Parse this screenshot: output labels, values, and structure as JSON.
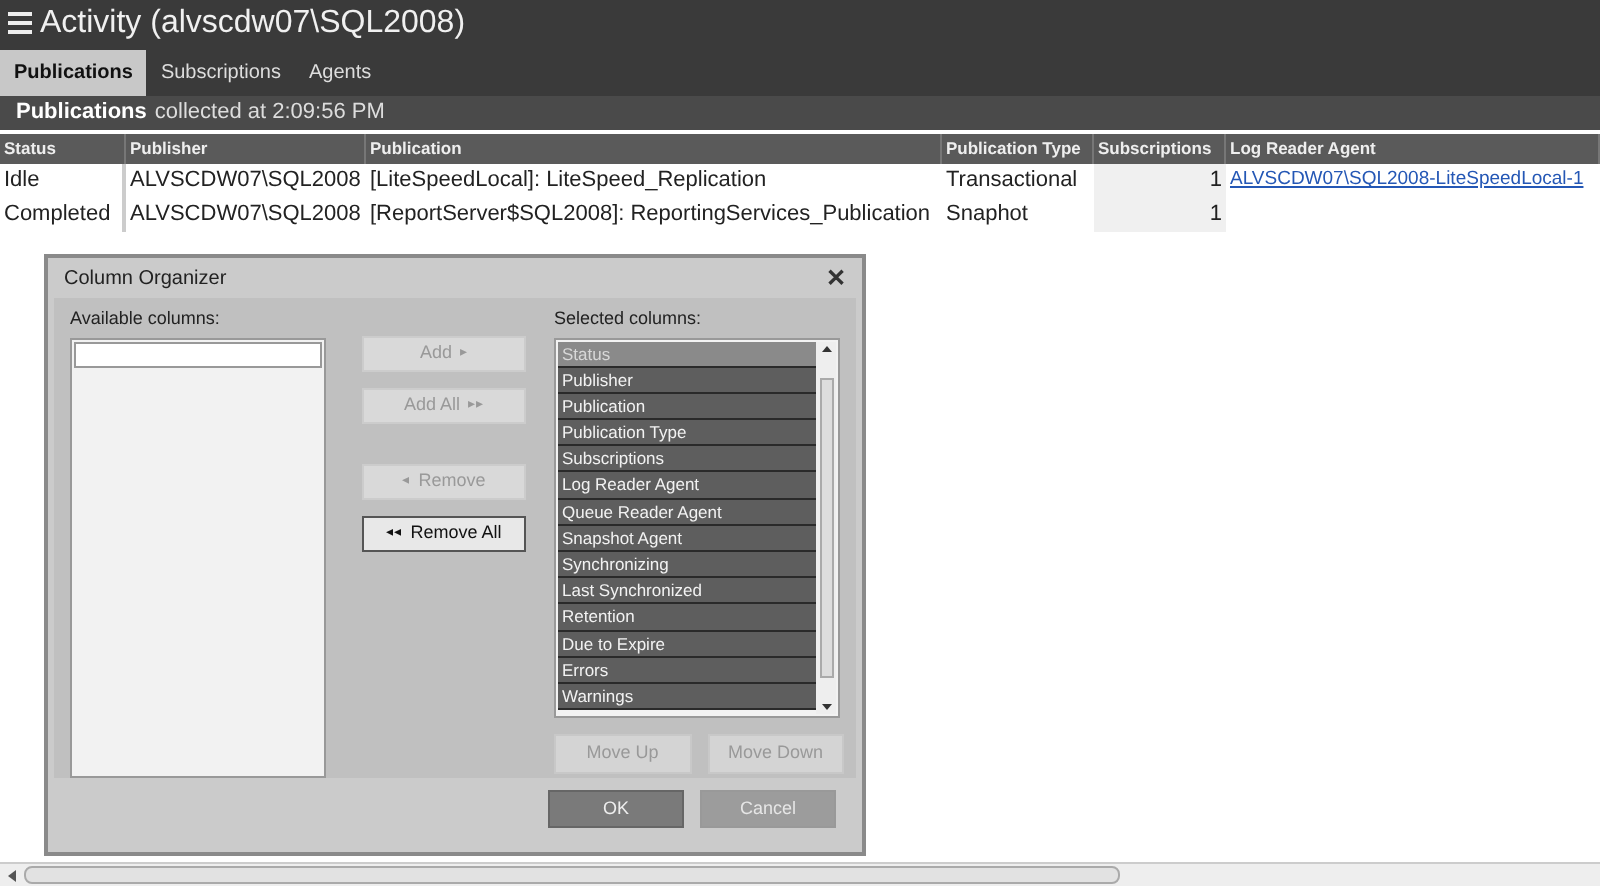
{
  "window": {
    "title": "Activity (alvscdw07\\SQL2008)"
  },
  "tabs": [
    {
      "label": "Publications",
      "selected": true
    },
    {
      "label": "Subscriptions",
      "selected": false
    },
    {
      "label": "Agents",
      "selected": false
    }
  ],
  "section": {
    "title": "Publications",
    "subtitle": "collected at 2:09:56 PM"
  },
  "table": {
    "columns": [
      "Status",
      "Publisher",
      "Publication",
      "Publication Type",
      "Subscriptions",
      "Log Reader Agent"
    ],
    "rows": [
      [
        "Idle",
        "ALVSCDW07\\SQL2008",
        "[LiteSpeedLocal]: LiteSpeed_Replication",
        "Transactional",
        "1",
        "ALVSCDW07\\SQL2008-LiteSpeedLocal-1"
      ],
      [
        "Completed",
        "ALVSCDW07\\SQL2008",
        "[ReportServer$SQL2008]: ReportingServices_Publication",
        "Snaphot",
        "1",
        ""
      ]
    ]
  },
  "dialog": {
    "title": "Column Organizer",
    "close": "✕",
    "available_label": "Available columns:",
    "selected_label": "Selected columns:",
    "middle_buttons": [
      {
        "label": "Add",
        "icon": "▸",
        "disabled": true
      },
      {
        "label": "Add All",
        "icon": "▸▸",
        "disabled": true
      },
      {
        "label": "Remove",
        "icon": "◂",
        "disabled": true
      },
      {
        "label": "Remove All",
        "icon": "◂◂",
        "disabled": false
      }
    ],
    "selected_columns": [
      {
        "label": "Status",
        "selected": true
      },
      {
        "label": "Publisher",
        "selected": false
      },
      {
        "label": "Publication",
        "selected": false
      },
      {
        "label": "Publication Type",
        "selected": false
      },
      {
        "label": "Subscriptions",
        "selected": false
      },
      {
        "label": "Log Reader Agent",
        "selected": false
      },
      {
        "label": "Queue Reader Agent",
        "selected": false
      },
      {
        "label": "Snapshot Agent",
        "selected": false
      },
      {
        "label": "Synchronizing",
        "selected": false
      },
      {
        "label": "Last Synchronized",
        "selected": false
      },
      {
        "label": "Retention",
        "selected": false
      },
      {
        "label": "Due to Expire",
        "selected": false
      },
      {
        "label": "Errors",
        "selected": false
      },
      {
        "label": "Warnings",
        "selected": false
      }
    ],
    "move_buttons": [
      {
        "label": "Move Up",
        "disabled": true
      },
      {
        "label": "Move Down",
        "disabled": true
      }
    ],
    "footer_buttons": [
      {
        "label": "OK",
        "kind": "primary"
      },
      {
        "label": "Cancel",
        "kind": "secondary"
      }
    ]
  }
}
